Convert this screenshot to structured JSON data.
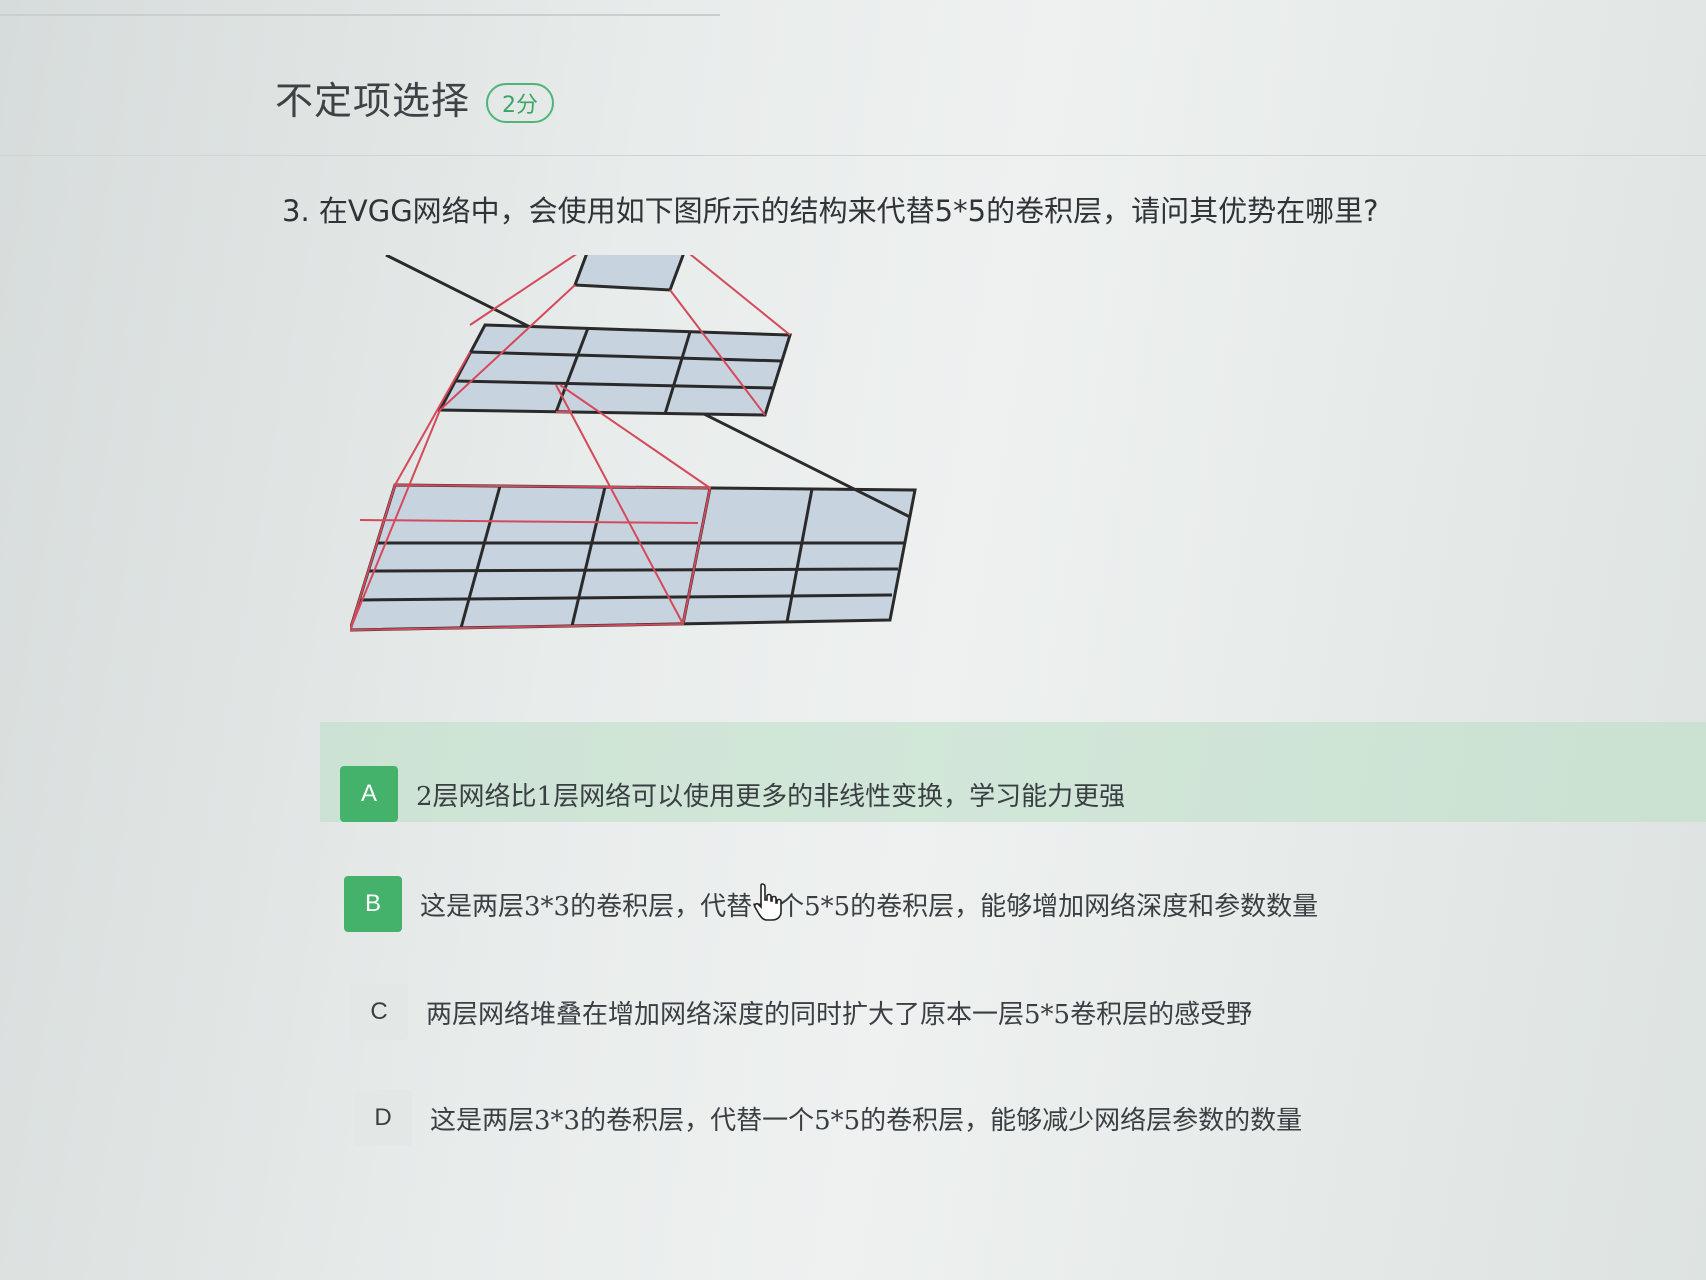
{
  "section": {
    "title": "不定项选择",
    "score": "2分"
  },
  "question": {
    "number": "3.",
    "text": "在VGG网络中，会使用如下图所示的结构来代替5*5的卷积层，请问其优势在哪里?"
  },
  "options": [
    {
      "letter": "A",
      "text": "2层网络比1层网络可以使用更多的非线性变换，学习能力更强",
      "selected": true
    },
    {
      "letter": "B",
      "text": "这是两层3*3的卷积层，代替一个5*5的卷积层，能够增加网络深度和参数数量",
      "selected": true
    },
    {
      "letter": "C",
      "text": "两层网络堆叠在增加网络深度的同时扩大了原本一层5*5卷积层的感受野",
      "selected": false
    },
    {
      "letter": "D",
      "text": "这是两层3*3的卷积层，代替一个5*5的卷积层，能够减少网络层参数的数量",
      "selected": false
    }
  ],
  "colors": {
    "accent": "#45b26b",
    "grid_fill": "#c8d3e0",
    "grid_line": "#2a2a2a",
    "receptive_line": "#d44a5a"
  }
}
